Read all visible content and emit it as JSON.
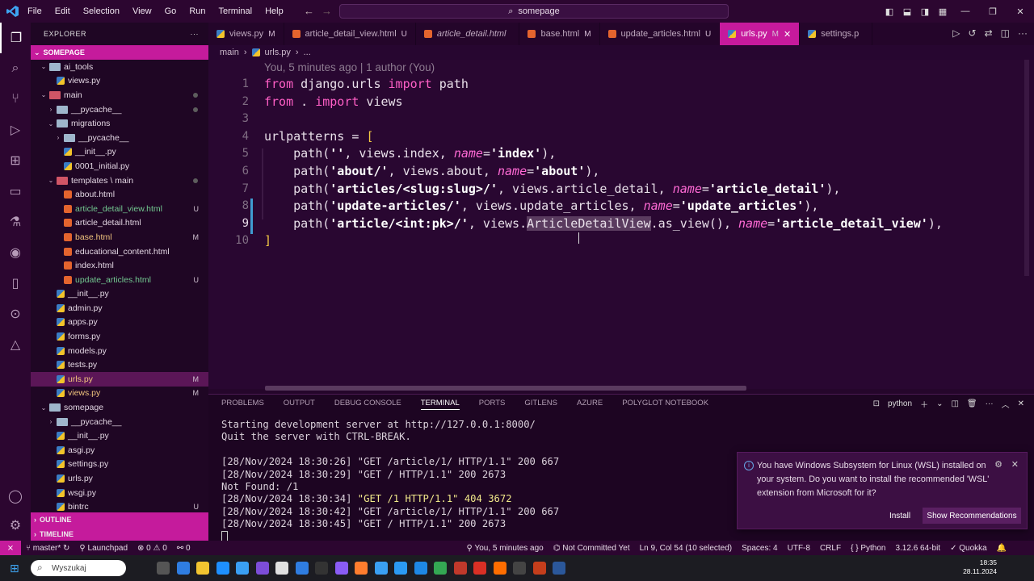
{
  "titlebar": {
    "menu": [
      "File",
      "Edit",
      "Selection",
      "View",
      "Go",
      "Run",
      "Terminal",
      "Help"
    ],
    "command_center": "somepage"
  },
  "sidebar": {
    "header": "EXPLORER",
    "project": "SOMEPAGE",
    "rows": [
      {
        "label": "ai_tools",
        "indent": 1,
        "type": "folder",
        "chev": "⌄"
      },
      {
        "label": "views.py",
        "indent": 2,
        "type": "py"
      },
      {
        "label": "main",
        "indent": 1,
        "type": "folder-red",
        "chev": "⌄",
        "dot": true,
        "cls": "redlbl"
      },
      {
        "label": "__pycache__",
        "indent": 2,
        "type": "folder",
        "chev": "›",
        "dot": true
      },
      {
        "label": "migrations",
        "indent": 2,
        "type": "folder",
        "chev": "⌄"
      },
      {
        "label": "__pycache__",
        "indent": 3,
        "type": "folder",
        "chev": "›"
      },
      {
        "label": "__init__.py",
        "indent": 3,
        "type": "py"
      },
      {
        "label": "0001_initial.py",
        "indent": 3,
        "type": "py"
      },
      {
        "label": "templates \\ main",
        "indent": 2,
        "type": "folder-red",
        "chev": "⌄",
        "dot": true
      },
      {
        "label": "about.html",
        "indent": 3,
        "type": "html"
      },
      {
        "label": "article_detail_view.html",
        "indent": 3,
        "type": "html",
        "badge": "U",
        "status": "unt"
      },
      {
        "label": "article_detail.html",
        "indent": 3,
        "type": "html"
      },
      {
        "label": "base.html",
        "indent": 3,
        "type": "html",
        "badge": "M",
        "status": "mod"
      },
      {
        "label": "educational_content.html",
        "indent": 3,
        "type": "html"
      },
      {
        "label": "index.html",
        "indent": 3,
        "type": "html"
      },
      {
        "label": "update_articles.html",
        "indent": 3,
        "type": "html",
        "badge": "U",
        "status": "unt"
      },
      {
        "label": "__init__.py",
        "indent": 2,
        "type": "py"
      },
      {
        "label": "admin.py",
        "indent": 2,
        "type": "py"
      },
      {
        "label": "apps.py",
        "indent": 2,
        "type": "py"
      },
      {
        "label": "forms.py",
        "indent": 2,
        "type": "py"
      },
      {
        "label": "models.py",
        "indent": 2,
        "type": "py"
      },
      {
        "label": "tests.py",
        "indent": 2,
        "type": "py"
      },
      {
        "label": "urls.py",
        "indent": 2,
        "type": "py",
        "badge": "M",
        "status": "mod",
        "selected": true
      },
      {
        "label": "views.py",
        "indent": 2,
        "type": "py",
        "badge": "M",
        "status": "mod"
      },
      {
        "label": "somepage",
        "indent": 1,
        "type": "folder",
        "chev": "⌄"
      },
      {
        "label": "__pycache__",
        "indent": 2,
        "type": "folder",
        "chev": "›"
      },
      {
        "label": "__init__.py",
        "indent": 2,
        "type": "py"
      },
      {
        "label": "asgi.py",
        "indent": 2,
        "type": "py"
      },
      {
        "label": "settings.py",
        "indent": 2,
        "type": "py"
      },
      {
        "label": "urls.py",
        "indent": 2,
        "type": "py"
      },
      {
        "label": "wsgi.py",
        "indent": 2,
        "type": "py"
      },
      {
        "label": "bintrc",
        "indent": 2,
        "type": "py",
        "badge": "U"
      }
    ],
    "outline": "OUTLINE",
    "timeline": "TIMELINE"
  },
  "tabs": [
    {
      "name": "views.py",
      "status": "M",
      "type": "py"
    },
    {
      "name": "article_detail_view.html",
      "status": "U",
      "type": "html"
    },
    {
      "name": "article_detail.html",
      "status": "",
      "type": "html",
      "italic": true
    },
    {
      "name": "base.html",
      "status": "M",
      "type": "html"
    },
    {
      "name": "update_articles.html",
      "status": "U",
      "type": "html"
    },
    {
      "name": "urls.py",
      "status": "M",
      "type": "py",
      "active": true
    },
    {
      "name": "settings.p",
      "status": "",
      "type": "py"
    }
  ],
  "breadcrumb": {
    "folder": "main",
    "file": "urls.py",
    "rest": "..."
  },
  "editor": {
    "blame": "You, 5 minutes ago | 1 author (You)",
    "current_line": 9,
    "line_numbers": [
      "1",
      "2",
      "3",
      "4",
      "5",
      "6",
      "7",
      "8",
      "9",
      "10"
    ]
  },
  "panel": {
    "tabs": [
      "PROBLEMS",
      "OUTPUT",
      "DEBUG CONSOLE",
      "TERMINAL",
      "PORTS",
      "GITLENS",
      "AZURE",
      "POLYGLOT NOTEBOOK"
    ],
    "active_tab": "TERMINAL",
    "shell": "python",
    "terminal_lines": [
      {
        "text": "Starting development server at http://127.0.0.1:8000/"
      },
      {
        "text": "Quit the server with CTRL-BREAK."
      },
      {
        "text": ""
      },
      {
        "text": "[28/Nov/2024 18:30:26] \"GET /article/1/ HTTP/1.1\" 200 667"
      },
      {
        "text": "[28/Nov/2024 18:30:29] \"GET / HTTP/1.1\" 200 2673"
      },
      {
        "text": "Not Found: /1"
      },
      {
        "pre": "[28/Nov/2024 18:30:34] ",
        "hl": "\"GET /1 HTTP/1.1\" 404 3672"
      },
      {
        "text": "[28/Nov/2024 18:30:42] \"GET /article/1/ HTTP/1.1\" 200 667"
      },
      {
        "text": "[28/Nov/2024 18:30:45] \"GET / HTTP/1.1\" 200 2673"
      }
    ]
  },
  "notification": {
    "message": "You have Windows Subsystem for Linux (WSL) installed on your system. Do you want to install the recommended 'WSL' extension from Microsoft for it?",
    "install": "Install",
    "show": "Show Recommendations"
  },
  "status": {
    "branch": "master*",
    "launchpad": "Launchpad",
    "errors": "⊗ 0 ⚠ 0",
    "ports": "⚯ 0",
    "blame": "You, 5 minutes ago",
    "commit": "Not Committed Yet",
    "position": "Ln 9, Col 54 (10 selected)",
    "spaces": "Spaces: 4",
    "encoding": "UTF-8",
    "eol": "CRLF",
    "language": "Python",
    "interpreter": "3.12.6 64-bit",
    "quokka": "Quokka"
  },
  "taskbar": {
    "search_placeholder": "Wyszukaj",
    "time": "18:35",
    "date": "28.11.2024"
  },
  "colors": {
    "accent": "#c51b9c",
    "background": "#290731",
    "keyword": "#ff5fc6",
    "string": "#ffffff",
    "param": "#ff6ad5"
  }
}
